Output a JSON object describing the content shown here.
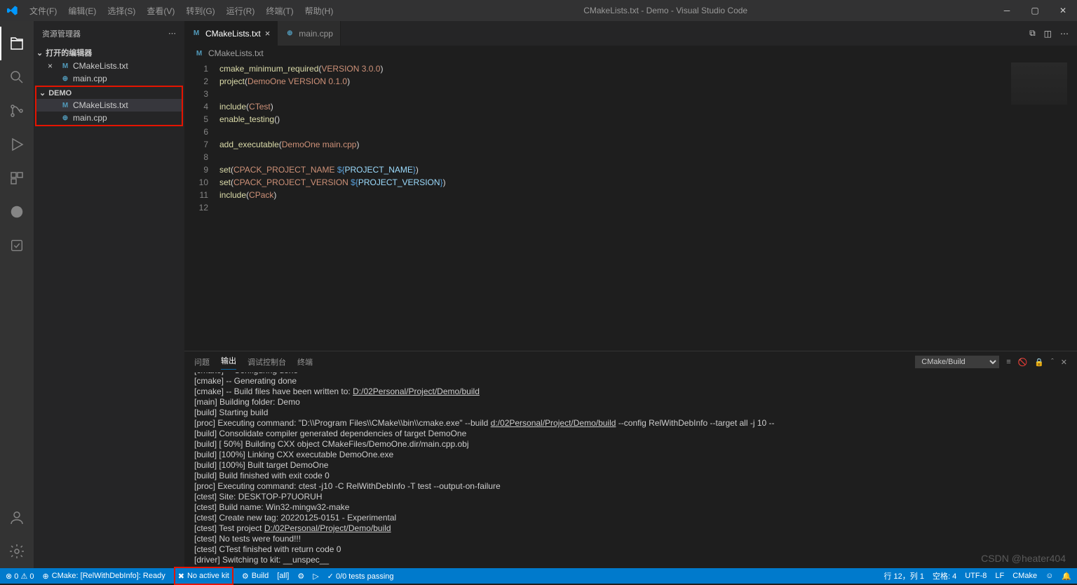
{
  "title": "CMakeLists.txt - Demo - Visual Studio Code",
  "menu": [
    "文件(F)",
    "编辑(E)",
    "选择(S)",
    "查看(V)",
    "转到(G)",
    "运行(R)",
    "终端(T)",
    "帮助(H)"
  ],
  "sidebar": {
    "title": "资源管理器",
    "open_editors": "打开的编辑器",
    "demo": "DEMO",
    "files_open": [
      {
        "icon": "m",
        "name": "CMakeLists.txt",
        "close": true
      },
      {
        "icon": "cpp",
        "name": "main.cpp",
        "close": false
      }
    ],
    "files_demo": [
      {
        "icon": "m",
        "name": "CMakeLists.txt",
        "sel": true
      },
      {
        "icon": "cpp",
        "name": "main.cpp",
        "sel": false
      }
    ]
  },
  "tabs": [
    {
      "icon": "m",
      "name": "CMakeLists.txt",
      "active": true
    },
    {
      "icon": "cpp",
      "name": "main.cpp",
      "active": false
    }
  ],
  "breadcrumb_file": "CMakeLists.txt",
  "code_lines": [
    [
      [
        "fn",
        "cmake_minimum_required"
      ],
      [
        "pun",
        "("
      ],
      [
        "str",
        "VERSION 3.0.0"
      ],
      [
        "pun",
        ")"
      ]
    ],
    [
      [
        "fn",
        "project"
      ],
      [
        "pun",
        "("
      ],
      [
        "str",
        "DemoOne VERSION 0.1.0"
      ],
      [
        "pun",
        ")"
      ]
    ],
    [],
    [
      [
        "fn",
        "include"
      ],
      [
        "pun",
        "("
      ],
      [
        "str",
        "CTest"
      ],
      [
        "pun",
        ")"
      ]
    ],
    [
      [
        "fn",
        "enable_testing"
      ],
      [
        "pun",
        "()"
      ]
    ],
    [],
    [
      [
        "fn",
        "add_executable"
      ],
      [
        "pun",
        "("
      ],
      [
        "str",
        "DemoOne main.cpp"
      ],
      [
        "pun",
        ")"
      ]
    ],
    [],
    [
      [
        "fn",
        "set"
      ],
      [
        "pun",
        "("
      ],
      [
        "str",
        "CPACK_PROJECT_NAME "
      ],
      [
        "kw",
        "${"
      ],
      [
        "var",
        "PROJECT_NAME"
      ],
      [
        "kw",
        "}"
      ],
      [
        "pun",
        ")"
      ]
    ],
    [
      [
        "fn",
        "set"
      ],
      [
        "pun",
        "("
      ],
      [
        "str",
        "CPACK_PROJECT_VERSION "
      ],
      [
        "kw",
        "${"
      ],
      [
        "var",
        "PROJECT_VERSION"
      ],
      [
        "kw",
        "}"
      ],
      [
        "pun",
        ")"
      ]
    ],
    [
      [
        "fn",
        "include"
      ],
      [
        "pun",
        "("
      ],
      [
        "str",
        "CPack"
      ],
      [
        "pun",
        ")"
      ]
    ],
    []
  ],
  "panel": {
    "tabs": [
      "问题",
      "输出",
      "调试控制台",
      "终端"
    ],
    "active": 1,
    "dropdown": "CMake/Build",
    "lines": [
      "[cmake] -- Configuring done",
      "[cmake] -- Generating done",
      "[cmake] -- Build files have been written to: |D:/02Personal/Project/Demo/build",
      "[main] Building folder: Demo",
      "[build] Starting build",
      "[proc] Executing command: \"D:\\\\Program Files\\\\CMake\\\\bin\\\\cmake.exe\" --build |d:/02Personal/Project/Demo/build| --config RelWithDebInfo --target all -j 10 --",
      "[build] Consolidate compiler generated dependencies of target DemoOne",
      "[build] [ 50%] Building CXX object CMakeFiles/DemoOne.dir/main.cpp.obj",
      "[build] [100%] Linking CXX executable DemoOne.exe",
      "[build] [100%] Built target DemoOne",
      "[build] Build finished with exit code 0",
      "[proc] Executing command: ctest -j10 -C RelWithDebInfo -T test --output-on-failure",
      "[ctest]    Site: DESKTOP-P7UORUH",
      "[ctest]    Build name: Win32-mingw32-make",
      "[ctest] Create new tag: 20220125-0151 - Experimental",
      "[ctest] Test project |D:/02Personal/Project/Demo/build",
      "[ctest] No tests were found!!!",
      "[ctest] CTest finished with return code 0",
      "[driver] Switching to kit: __unspec__"
    ]
  },
  "status": {
    "errors": "⊗ 0 ⚠ 0",
    "cmake": "CMake: [RelWithDebInfo]: Ready",
    "kit": "No active kit",
    "build": "Build",
    "target": "[all]",
    "tests": "✓ 0/0 tests passing",
    "pos": "行 12，列 1",
    "spaces": "空格: 4",
    "enc": "UTF-8",
    "eol": "LF",
    "lang": "CMake",
    "bell": "🔔"
  },
  "watermark": "CSDN @heater404"
}
